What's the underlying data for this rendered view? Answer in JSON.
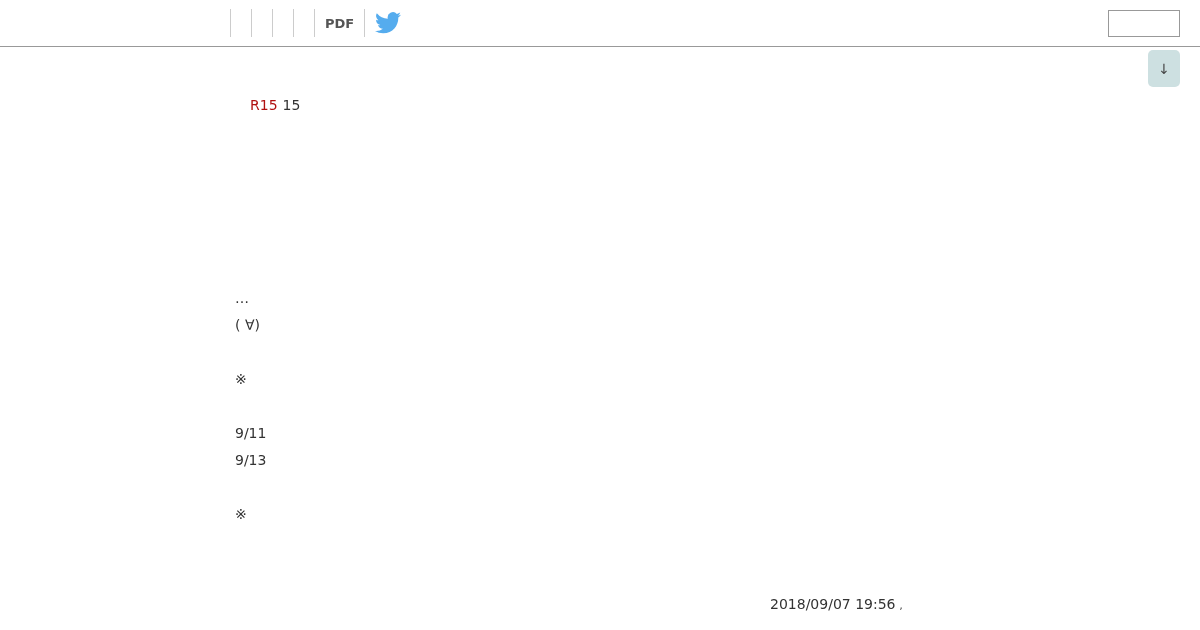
{
  "header": {
    "nav_items": [
      {
        "kind": "empty"
      },
      {
        "kind": "empty"
      },
      {
        "kind": "empty"
      },
      {
        "kind": "empty"
      },
      {
        "kind": "text",
        "label": "PDF"
      },
      {
        "kind": "twitter"
      }
    ]
  },
  "scroll_button": {
    "label": "↓"
  },
  "rating": {
    "tag": "R15",
    "text": "15"
  },
  "paragraphs": [
    [
      "…",
      "( ∀)"
    ],
    [
      "※"
    ],
    [
      "9/11",
      "9/13"
    ],
    [
      "※"
    ]
  ],
  "timestamp": "2018/09/07 19:56",
  "timestamp_suffix": ","
}
